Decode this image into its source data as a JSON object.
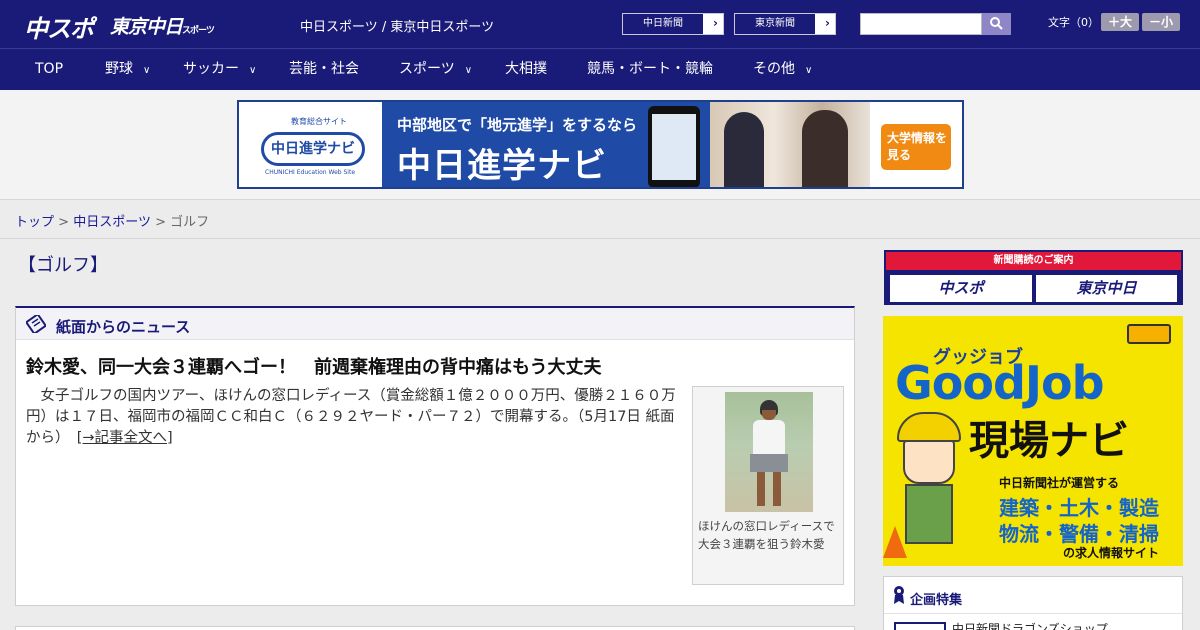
{
  "header": {
    "logo_chuspo": "中スポ",
    "logo_tokyo": "東京中日",
    "logo_tokyo_small": "スポーツ",
    "site_title": "中日スポーツ / 東京中日スポーツ",
    "ext_links": [
      "中日新聞",
      "東京新聞"
    ],
    "search_placeholder": "",
    "font_size_label": "文字（0）",
    "font_larger": "＋大",
    "font_smaller": "－小",
    "accent_color": "#1a1a78"
  },
  "nav": {
    "items": [
      {
        "label": "TOP",
        "has_menu": false
      },
      {
        "label": "野球",
        "has_menu": true
      },
      {
        "label": "サッカー",
        "has_menu": true
      },
      {
        "label": "芸能・社会",
        "has_menu": false
      },
      {
        "label": "スポーツ",
        "has_menu": true
      },
      {
        "label": "大相撲",
        "has_menu": false
      },
      {
        "label": "競馬・ボート・競輪",
        "has_menu": false
      },
      {
        "label": "その他",
        "has_menu": true
      }
    ]
  },
  "banner": {
    "site_small": "教育総合サイト",
    "site_name": "中日進学ナビ",
    "site_en": "CHUNICHI Education Web Site",
    "copy_line1": "中部地区で「地元進学」をするなら",
    "copy_line2": "中日進学ナビ",
    "cta": "大学情報を見る"
  },
  "breadcrumb": {
    "items": [
      "トップ",
      "中日スポーツ"
    ],
    "current": "ゴルフ",
    "separator": ">"
  },
  "page": {
    "heading": "【ゴルフ】"
  },
  "news": {
    "section_title": "紙面からのニュース",
    "article": {
      "title": "鈴木愛、同一大会３連覇へゴー！　前週棄権理由の背中痛はもう大丈夫",
      "body": "　女子ゴルフの国内ツアー、ほけんの窓口レディース（賞金総額１億２０００万円、優勝２１６０万円）は１７日、福岡市の福岡ＣＣ和白Ｃ（６２９２ヤード・パー７２）で開幕する。（5月17日 紙面から）",
      "more": "[→記事全文へ]",
      "photo_caption": "ほけんの窓口レディースで大会３連覇を狙う鈴木愛"
    }
  },
  "sidebar": {
    "subscription": {
      "header": "新聞購読のご案内",
      "buttons": [
        "中スポ",
        "東京中日"
      ]
    },
    "goodjob_ad": {
      "sub": "グッジョブ",
      "main": "GoodJob",
      "title": "現場ナビ",
      "line1": "中日新聞社が運営する",
      "line2": "建築・土木・製造",
      "line3": "物流・警備・清掃",
      "line4": "の求人情報サイト"
    },
    "features": {
      "title": "企画特集",
      "first_item": "中日新聞ドラゴンズショップ"
    }
  }
}
